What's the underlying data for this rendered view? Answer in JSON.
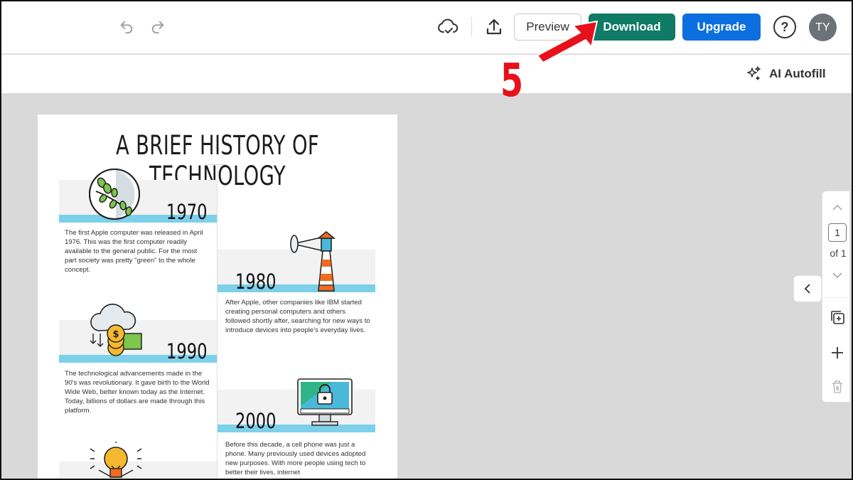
{
  "toolbar": {
    "undo_icon": "undo-icon",
    "redo_icon": "redo-icon",
    "cloud_icon": "cloud-check-icon",
    "upload_icon": "upload-icon",
    "preview_label": "Preview",
    "download_label": "Download",
    "upgrade_label": "Upgrade",
    "help_label": "?",
    "avatar_initials": "TY",
    "colors": {
      "download": "#0f7a66",
      "upgrade": "#0b6fe0"
    }
  },
  "subbar": {
    "autofill_label": "AI Autofill",
    "autofill_icon": "sparkle-icon"
  },
  "annotation": {
    "step_number": "5",
    "arrow_color": "#e8101a"
  },
  "document": {
    "title": "A BRIEF HISTORY OF TECHNOLOGY",
    "entries": [
      {
        "year": "1970",
        "text": "The first Apple computer was released in April 1976. This was the first computer readily available to the general public. For the most part society was pretty \"green\" to the whole concept.",
        "icon": "leaf-circle-icon"
      },
      {
        "year": "1980",
        "text": "After Apple, other companies like IBM started creating personal computers and others followed shortly after, searching for new ways to introduce devices into people's everyday lives.",
        "icon": "lighthouse-icon"
      },
      {
        "year": "1990",
        "text": "The technological advancements made in the 90's was revolutionary. It gave birth to the World Wide Web, better known today as the Internet. Today, billions of dollars are made through this platform.",
        "icon": "cloud-money-icon"
      },
      {
        "year": "2000",
        "text": "Before this decade, a cell phone was just a phone. Many previously used devices adopted new purposes. With more people using tech to better their lives, internet",
        "icon": "monitor-lock-icon"
      }
    ],
    "accent_color": "#7cd0ea"
  },
  "pager": {
    "current": "1",
    "of_label": "of 1"
  }
}
